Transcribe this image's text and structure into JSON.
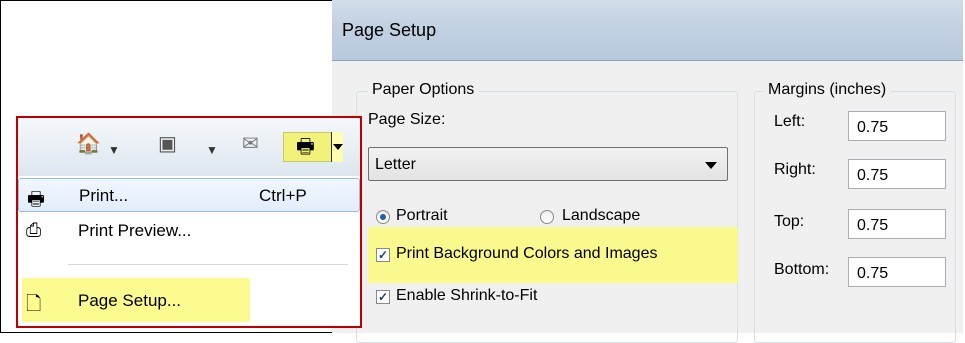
{
  "dialog": {
    "title": "Page Setup",
    "paper_options": {
      "legend": "Paper Options",
      "page_size_label": "Page Size:",
      "page_size_value": "Letter",
      "orientation": {
        "portrait_label": "Portrait",
        "landscape_label": "Landscape",
        "selected": "Portrait"
      },
      "print_background_label": "Print Background Colors and Images",
      "print_background_checked": true,
      "shrink_to_fit_label": "Enable Shrink-to-Fit",
      "shrink_to_fit_checked": true
    },
    "margins": {
      "legend": "Margins (inches)",
      "left_label": "Left:",
      "left_value": "0.75",
      "right_label": "Right:",
      "right_value": "0.75",
      "top_label": "Top:",
      "top_value": "0.75",
      "bottom_label": "Bottom:",
      "bottom_value": "0.75"
    }
  },
  "toolbar": {
    "icons": [
      "home-icon",
      "feeds-icon",
      "mail-icon",
      "print-icon"
    ],
    "highlight_color": "#fafa7d",
    "frame_color": "#c00000"
  },
  "menu": {
    "items": [
      {
        "label": "Print...",
        "shortcut": "Ctrl+P",
        "icon": "printer-icon"
      },
      {
        "label": "Print Preview...",
        "shortcut": "",
        "icon": "print-preview-icon"
      },
      {
        "label": "Page Setup...",
        "shortcut": "",
        "icon": "page-setup-icon"
      }
    ]
  }
}
